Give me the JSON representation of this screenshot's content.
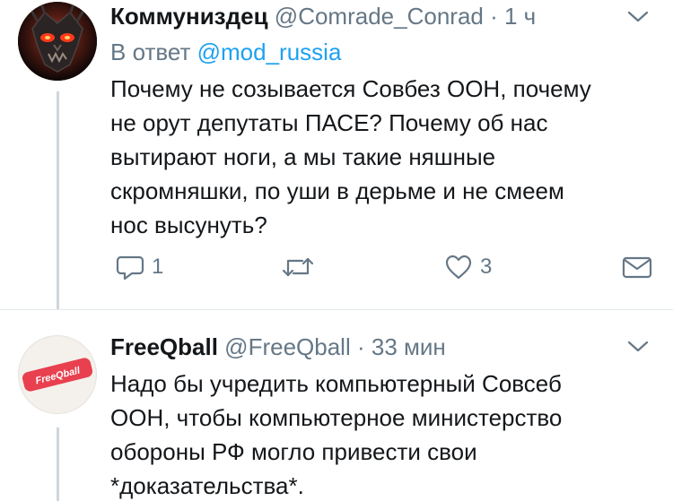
{
  "tweets": [
    {
      "name": "Коммуниздец",
      "handle": "@Comrade_Conrad",
      "dot": "·",
      "time": "1 ч",
      "reply_prefix": "В ответ",
      "reply_mention": "@mod_russia",
      "body_lines": [
        "Почему не созывается Совбез ООН, почему",
        "не орут депутаты ПАСЕ? Почему об нас",
        "вытирают ноги, а мы такие няшные",
        "скромняшки, по уши в дерьме и не смеем",
        "нос высунуть?"
      ],
      "reply_count": "1",
      "retweet_count": "",
      "like_count": "3",
      "avatar_icon": "dark-skull-mask-icon"
    },
    {
      "name": "FreeQball",
      "handle": "@FreeQball",
      "dot": "·",
      "time": "33 мин",
      "avatar_label": "FreeQball",
      "body_lines": [
        "Надо бы учредить компьютерный Совсеб",
        "ООН, чтобы компьютерное министерство",
        "обороны РФ могло привести свои",
        "*доказательства*."
      ]
    }
  ],
  "colors": {
    "text": "#14171a",
    "secondary": "#657786",
    "link": "#1da1f2",
    "thread_line": "#ccd6dd",
    "divider": "#e1e8ed",
    "avatar_brand": "#e8404f"
  }
}
